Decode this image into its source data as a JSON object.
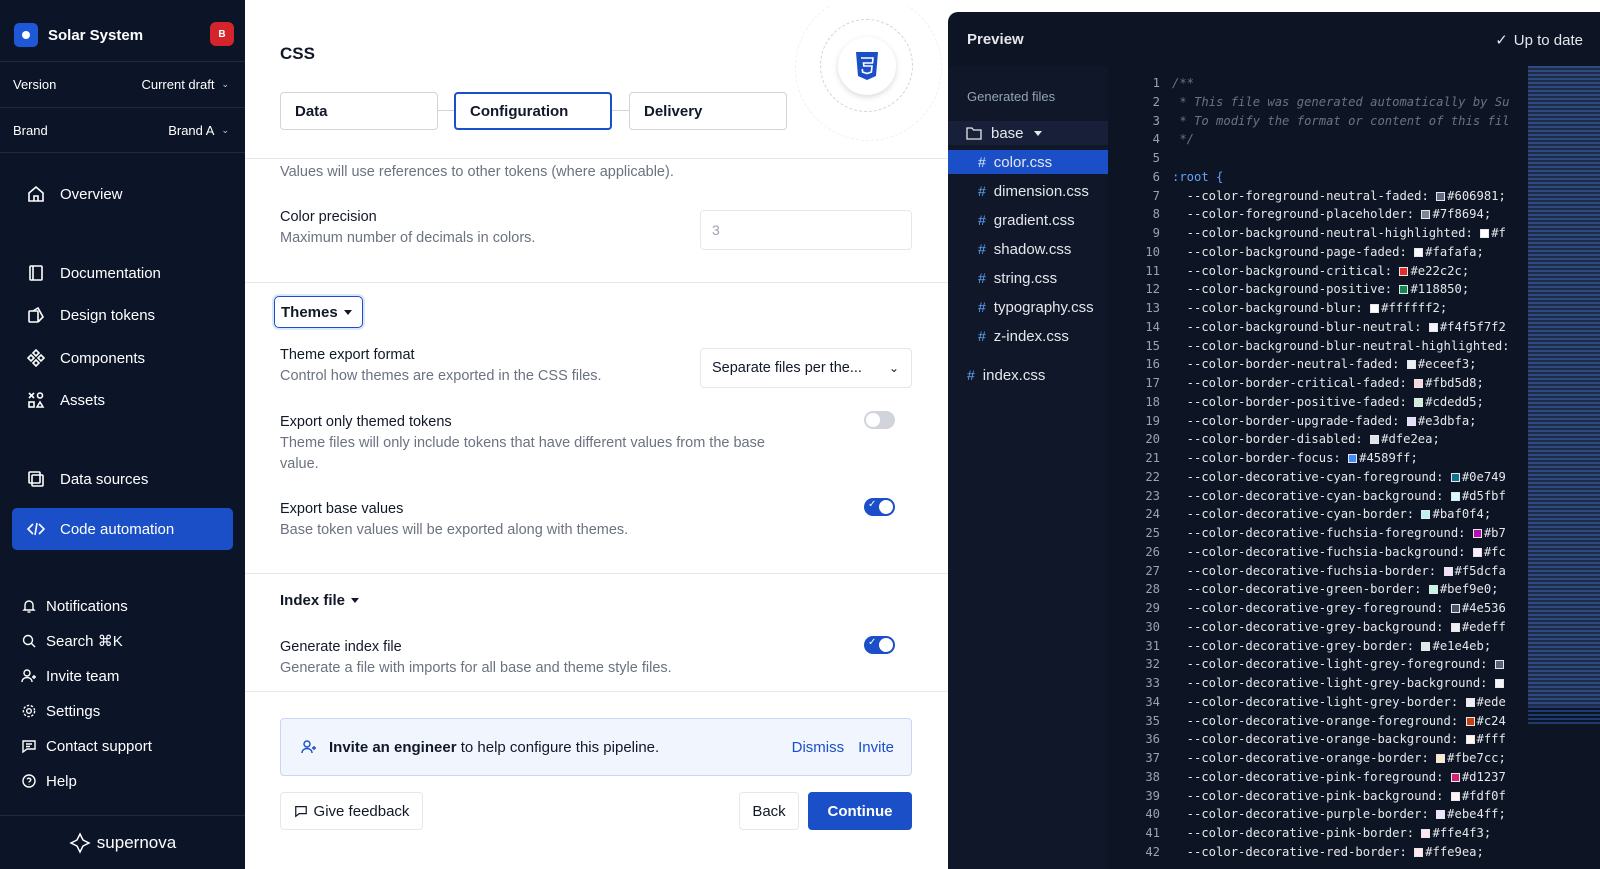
{
  "workspace": {
    "name": "Solar System",
    "avatar": "B"
  },
  "version": {
    "label": "Version",
    "value": "Current draft"
  },
  "brand": {
    "label": "Brand",
    "value": "Brand A"
  },
  "nav": {
    "overview": "Overview",
    "documentation": "Documentation",
    "design_tokens": "Design tokens",
    "components": "Components",
    "assets": "Assets",
    "data_sources": "Data sources",
    "code_automation": "Code automation"
  },
  "nav_bottom": {
    "notifications": "Notifications",
    "search": "Search ⌘K",
    "invite": "Invite team",
    "settings": "Settings",
    "support": "Contact support",
    "help": "Help"
  },
  "footer": {
    "logo_text": "supernova"
  },
  "page": {
    "title": "CSS",
    "tabs": [
      "Data",
      "Configuration",
      "Delivery"
    ]
  },
  "settings": {
    "references_desc": "Values will use references to other tokens (where applicable).",
    "color_precision": {
      "label": "Color precision",
      "desc": "Maximum number of decimals in colors.",
      "placeholder": "3"
    },
    "themes": {
      "section": "Themes",
      "export_format": {
        "label": "Theme export format",
        "desc": "Control how themes are exported in the CSS files.",
        "value": "Separate files per the..."
      },
      "only_themed": {
        "label": "Export only themed tokens",
        "desc1": "Theme files will only include tokens that have different values from the base",
        "desc2": "value.",
        "enabled": false
      },
      "base_values": {
        "label": "Export base values",
        "desc": "Base token values will be exported along with themes.",
        "enabled": true
      }
    },
    "index": {
      "section": "Index file",
      "generate": {
        "label": "Generate index file",
        "desc": "Generate a file with imports for all base and theme style files.",
        "enabled": true
      }
    }
  },
  "banner": {
    "bold": "Invite an engineer",
    "rest": " to help configure this pipeline.",
    "dismiss": "Dismiss",
    "invite": "Invite"
  },
  "actions": {
    "feedback": "Give feedback",
    "back": "Back",
    "continue": "Continue"
  },
  "preview": {
    "title": "Preview",
    "status": "Up to date",
    "files_heading": "Generated files",
    "folder": "base",
    "files": [
      "color.css",
      "dimension.css",
      "gradient.css",
      "shadow.css",
      "string.css",
      "typography.css",
      "z-index.css"
    ],
    "root_file": "index.css",
    "selected_file": "color.css",
    "code": [
      {
        "n": "1",
        "t": "/**",
        "k": "c"
      },
      {
        "n": "2",
        "t": " * This file was generated automatically by Su",
        "k": "c"
      },
      {
        "n": "3",
        "t": " * To modify the format or content of this fil",
        "k": "c"
      },
      {
        "n": "4",
        "t": " */",
        "k": "c"
      },
      {
        "n": "5",
        "t": "",
        "k": "p"
      },
      {
        "n": "6",
        "t": ":root {",
        "k": "s"
      },
      {
        "n": "7",
        "t": "  --color-foreground-neutral-faded: ",
        "v": "#606981;",
        "sw": "#606981"
      },
      {
        "n": "8",
        "t": "  --color-foreground-placeholder: ",
        "v": "#7f8694;",
        "sw": "#7f8694"
      },
      {
        "n": "9",
        "t": "  --color-background-neutral-highlighted: ",
        "v": "#f",
        "sw": "#ffffff"
      },
      {
        "n": "10",
        "t": "  --color-background-page-faded: ",
        "v": "#fafafa;",
        "sw": "#fafafa"
      },
      {
        "n": "11",
        "t": "  --color-background-critical: ",
        "v": "#e22c2c;",
        "sw": "#e22c2c"
      },
      {
        "n": "12",
        "t": "  --color-background-positive: ",
        "v": "#118850;",
        "sw": "#118850"
      },
      {
        "n": "13",
        "t": "  --color-background-blur: ",
        "v": "#ffffff2;",
        "sw": "#ffffff"
      },
      {
        "n": "14",
        "t": "  --color-background-blur-neutral: ",
        "v": "#f4f5f7f2",
        "sw": "#f4f5f7"
      },
      {
        "n": "15",
        "t": "  --color-background-blur-neutral-highlighted:",
        "k": "p"
      },
      {
        "n": "16",
        "t": "  --color-border-neutral-faded: ",
        "v": "#eceef3;",
        "sw": "#eceef3"
      },
      {
        "n": "17",
        "t": "  --color-border-critical-faded: ",
        "v": "#fbd5d8;",
        "sw": "#fbd5d8"
      },
      {
        "n": "18",
        "t": "  --color-border-positive-faded: ",
        "v": "#cdedd5;",
        "sw": "#cdedd5"
      },
      {
        "n": "19",
        "t": "  --color-border-upgrade-faded: ",
        "v": "#e3dbfa;",
        "sw": "#e3dbfa"
      },
      {
        "n": "20",
        "t": "  --color-border-disabled: ",
        "v": "#dfe2ea;",
        "sw": "#dfe2ea"
      },
      {
        "n": "21",
        "t": "  --color-border-focus: ",
        "v": "#4589ff;",
        "sw": "#4589ff"
      },
      {
        "n": "22",
        "t": "  --color-decorative-cyan-foreground: ",
        "v": "#0e749",
        "sw": "#0e7490"
      },
      {
        "n": "23",
        "t": "  --color-decorative-cyan-background: ",
        "v": "#d5fbf",
        "sw": "#d5fbff"
      },
      {
        "n": "24",
        "t": "  --color-decorative-cyan-border: ",
        "v": "#baf0f4;",
        "sw": "#baf0f4"
      },
      {
        "n": "25",
        "t": "  --color-decorative-fuchsia-foreground: ",
        "v": "#b7",
        "sw": "#b70fb2"
      },
      {
        "n": "26",
        "t": "  --color-decorative-fuchsia-background: ",
        "v": "#fc",
        "sw": "#fceefc"
      },
      {
        "n": "27",
        "t": "  --color-decorative-fuchsia-border: ",
        "v": "#f5dcfa",
        "sw": "#f5dcfa"
      },
      {
        "n": "28",
        "t": "  --color-decorative-green-border: ",
        "v": "#bef9e0;",
        "sw": "#bef9e0"
      },
      {
        "n": "29",
        "t": "  --color-decorative-grey-foreground: ",
        "v": "#4e536",
        "sw": "#4e5366"
      },
      {
        "n": "30",
        "t": "  --color-decorative-grey-background: ",
        "v": "#edeff",
        "sw": "#edeff2"
      },
      {
        "n": "31",
        "t": "  --color-decorative-grey-border: ",
        "v": "#e1e4eb;",
        "sw": "#e1e4eb"
      },
      {
        "n": "32",
        "t": "  --color-decorative-light-grey-foreground: ",
        "v": "",
        "sw": "#5c6275"
      },
      {
        "n": "33",
        "t": "  --color-decorative-light-grey-background: ",
        "v": "",
        "sw": "#f5f6f8"
      },
      {
        "n": "34",
        "t": "  --color-decorative-light-grey-border: ",
        "v": "#ede",
        "sw": "#edeef2"
      },
      {
        "n": "35",
        "t": "  --color-decorative-orange-foreground: ",
        "v": "#c24",
        "sw": "#c2410c"
      },
      {
        "n": "36",
        "t": "  --color-decorative-orange-background: ",
        "v": "#fff",
        "sw": "#fff7ed"
      },
      {
        "n": "37",
        "t": "  --color-decorative-orange-border: ",
        "v": "#fbe7cc;",
        "sw": "#fbe7cc"
      },
      {
        "n": "38",
        "t": "  --color-decorative-pink-foreground: ",
        "v": "#d1237",
        "sw": "#d12372"
      },
      {
        "n": "39",
        "t": "  --color-decorative-pink-background: ",
        "v": "#fdf0f",
        "sw": "#fdf0f6"
      },
      {
        "n": "40",
        "t": "  --color-decorative-purple-border: ",
        "v": "#ebe4ff;",
        "sw": "#ebe4ff"
      },
      {
        "n": "41",
        "t": "  --color-decorative-pink-border: ",
        "v": "#ffe4f3;",
        "sw": "#ffe4f3"
      },
      {
        "n": "42",
        "t": "  --color-decorative-red-border: ",
        "v": "#ffe9ea;",
        "sw": "#ffe9ea"
      }
    ]
  },
  "colors": {
    "accent": "#1a4fc7",
    "sidebar_bg": "#0c1528",
    "preview_bg": "#0d1424"
  }
}
